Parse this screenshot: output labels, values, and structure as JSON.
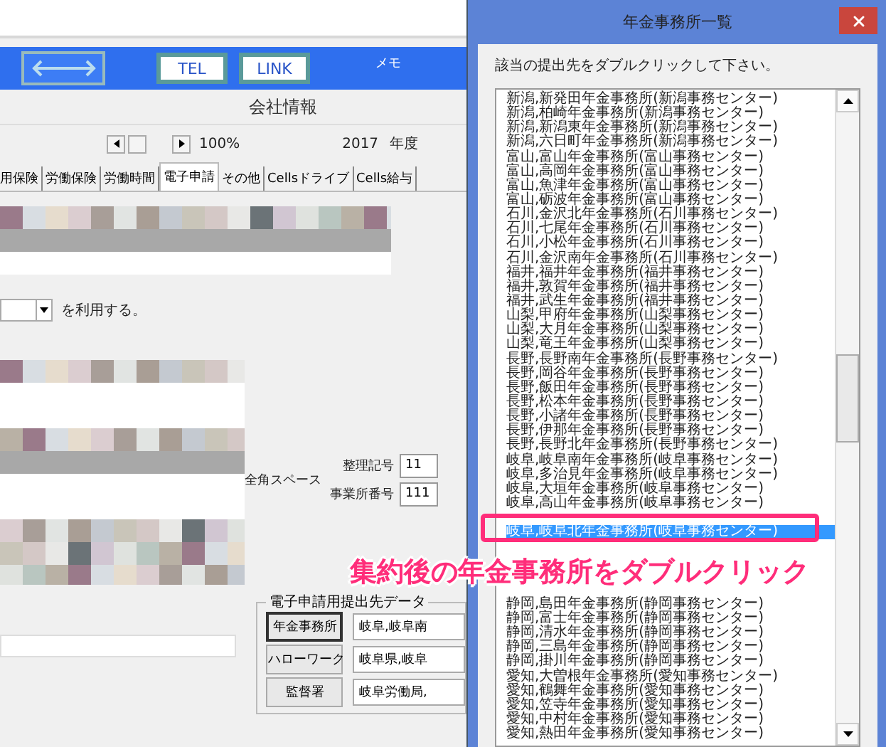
{
  "app": {
    "toolbar": {
      "buttons": [
        {
          "label": "TEL"
        },
        {
          "label": "LINK"
        }
      ],
      "memo_label": "メモ"
    },
    "title": "会社情報",
    "zoom": "100%",
    "year": "2017",
    "year_unit": "年度",
    "tabs": [
      {
        "label": "用保険",
        "selected": false
      },
      {
        "label": "労働保険",
        "selected": false
      },
      {
        "label": "労働時間",
        "selected": false
      },
      {
        "label": "電子申請",
        "selected": true
      },
      {
        "label": "その他",
        "selected": false
      },
      {
        "label": "Cellsドライブ",
        "selected": false
      },
      {
        "label": "Cells給与",
        "selected": false
      }
    ],
    "use_suffix": "を利用する。",
    "space_note": "全角スペース",
    "fields": [
      {
        "label": "整理記号",
        "value": "11"
      },
      {
        "label": "事業所番号",
        "value": "111"
      }
    ],
    "submission": {
      "title": "電子申請用提出先データ",
      "rows": [
        {
          "button": "年金事務所",
          "value": "岐阜,岐阜南",
          "focused": true
        },
        {
          "button": "ハローワーク",
          "value": "岐阜県,岐阜",
          "focused": false
        },
        {
          "button": "監督署",
          "value": "岐阜労働局,",
          "focused": false
        }
      ]
    }
  },
  "dialog": {
    "title": "年金事務所一覧",
    "instruction": "該当の提出先をダブルクリックして下さい。",
    "items": [
      {
        "kind": "entry",
        "text": "新潟,新発田年金事務所(新潟事務センター)",
        "selected": false
      },
      {
        "kind": "entry",
        "text": "新潟,柏崎年金事務所(新潟事務センター)",
        "selected": false
      },
      {
        "kind": "entry",
        "text": "新潟,新潟東年金事務所(新潟事務センター)",
        "selected": false
      },
      {
        "kind": "entry",
        "text": "新潟,六日町年金事務所(新潟事務センター)",
        "selected": false
      },
      {
        "kind": "entry",
        "text": "富山,富山年金事務所(富山事務センター)",
        "selected": false
      },
      {
        "kind": "entry",
        "text": "富山,高岡年金事務所(富山事務センター)",
        "selected": false
      },
      {
        "kind": "entry",
        "text": "富山,魚津年金事務所(富山事務センター)",
        "selected": false
      },
      {
        "kind": "entry",
        "text": "富山,砺波年金事務所(富山事務センター)",
        "selected": false
      },
      {
        "kind": "entry",
        "text": "石川,金沢北年金事務所(石川事務センター)",
        "selected": false
      },
      {
        "kind": "entry",
        "text": "石川,七尾年金事務所(石川事務センター)",
        "selected": false
      },
      {
        "kind": "entry",
        "text": "石川,小松年金事務所(石川事務センター)",
        "selected": false
      },
      {
        "kind": "entry",
        "text": "石川,金沢南年金事務所(石川事務センター)",
        "selected": false
      },
      {
        "kind": "entry",
        "text": "福井,福井年金事務所(福井事務センター)",
        "selected": false
      },
      {
        "kind": "entry",
        "text": "福井,敦賀年金事務所(福井事務センター)",
        "selected": false
      },
      {
        "kind": "entry",
        "text": "福井,武生年金事務所(福井事務センター)",
        "selected": false
      },
      {
        "kind": "entry",
        "text": "山梨,甲府年金事務所(山梨事務センター)",
        "selected": false
      },
      {
        "kind": "entry",
        "text": "山梨,大月年金事務所(山梨事務センター)",
        "selected": false
      },
      {
        "kind": "entry",
        "text": "山梨,竜王年金事務所(山梨事務センター)",
        "selected": false
      },
      {
        "kind": "entry",
        "text": "長野,長野南年金事務所(長野事務センター)",
        "selected": false
      },
      {
        "kind": "entry",
        "text": "長野,岡谷年金事務所(長野事務センター)",
        "selected": false
      },
      {
        "kind": "entry",
        "text": "長野,飯田年金事務所(長野事務センター)",
        "selected": false
      },
      {
        "kind": "entry",
        "text": "長野,松本年金事務所(長野事務センター)",
        "selected": false
      },
      {
        "kind": "entry",
        "text": "長野,小諸年金事務所(長野事務センター)",
        "selected": false
      },
      {
        "kind": "entry",
        "text": "長野,伊那年金事務所(長野事務センター)",
        "selected": false
      },
      {
        "kind": "entry",
        "text": "長野,長野北年金事務所(長野事務センター)",
        "selected": false
      },
      {
        "kind": "entry",
        "text": "岐阜,岐阜南年金事務所(岐阜事務センター)",
        "selected": false
      },
      {
        "kind": "entry",
        "text": "岐阜,多治見年金事務所(岐阜事務センター)",
        "selected": false
      },
      {
        "kind": "entry",
        "text": "岐阜,大垣年金事務所(岐阜事務センター)",
        "selected": false
      },
      {
        "kind": "entry",
        "text": "岐阜,高山年金事務所(岐阜事務センター)",
        "selected": false
      },
      {
        "kind": "covered"
      },
      {
        "kind": "entry",
        "text": "岐阜,岐阜北年金事務所(岐阜事務センター)",
        "selected": true
      },
      {
        "kind": "covered"
      },
      {
        "kind": "covered"
      },
      {
        "kind": "covered"
      },
      {
        "kind": "covered"
      },
      {
        "kind": "entry",
        "text": "静岡,島田年金事務所(静岡事務センター)",
        "selected": false
      },
      {
        "kind": "entry",
        "text": "静岡,富士年金事務所(静岡事務センター)",
        "selected": false
      },
      {
        "kind": "entry",
        "text": "静岡,清水年金事務所(静岡事務センター)",
        "selected": false
      },
      {
        "kind": "entry",
        "text": "静岡,三島年金事務所(静岡事務センター)",
        "selected": false
      },
      {
        "kind": "entry",
        "text": "静岡,掛川年金事務所(静岡事務センター)",
        "selected": false
      },
      {
        "kind": "entry",
        "text": "愛知,大曽根年金事務所(愛知事務センター)",
        "selected": false
      },
      {
        "kind": "entry",
        "text": "愛知,鶴舞年金事務所(愛知事務センター)",
        "selected": false
      },
      {
        "kind": "entry",
        "text": "愛知,笠寺年金事務所(愛知事務センター)",
        "selected": false
      },
      {
        "kind": "entry",
        "text": "愛知,中村年金事務所(愛知事務センター)",
        "selected": false
      },
      {
        "kind": "entry",
        "text": "愛知,熱田年金事務所(愛知事務センター)",
        "selected": false
      }
    ]
  },
  "callout": "集約後の年金事務所をダブルクリック"
}
